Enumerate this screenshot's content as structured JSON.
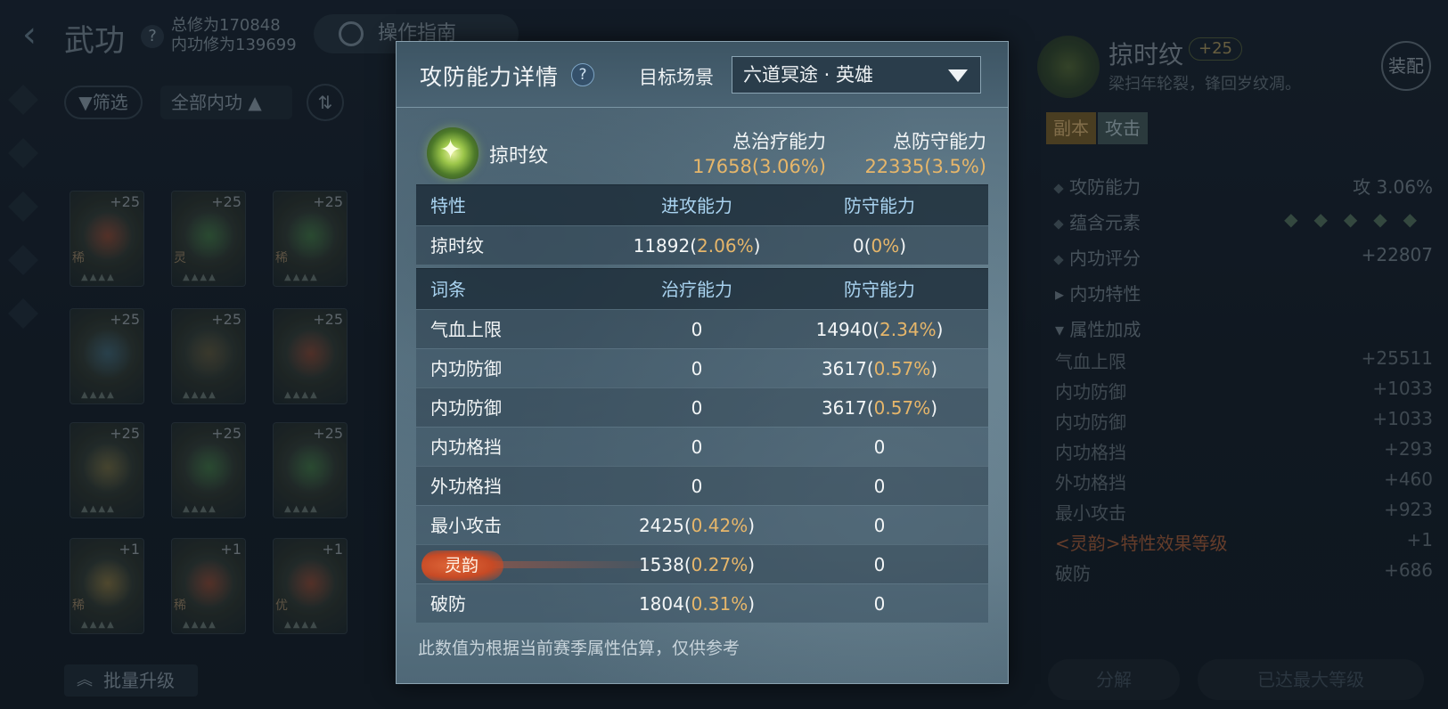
{
  "header": {
    "title": "武功",
    "help": "?",
    "total_cultivation": "总修为170848",
    "inner_cultivation": "内功修为139699",
    "guide_label": "操作指南"
  },
  "toolbar": {
    "filter_label": "筛选",
    "all_label": "全部内功",
    "sort_icon": "sort-icon",
    "batch_upgrade_label": "批量升级"
  },
  "grid": {
    "cards": [
      {
        "level": "+25",
        "rarity": "稀",
        "color": "#b2432a"
      },
      {
        "level": "+25",
        "rarity": "灵",
        "color": "#3f8a43"
      },
      {
        "level": "+25",
        "rarity": "稀",
        "color": "#3f8a43"
      },
      {
        "level": "+25",
        "rarity": "",
        "color": "#3c6f8c"
      },
      {
        "level": "+25",
        "rarity": "",
        "color": "#6b5a35"
      },
      {
        "level": "+25",
        "rarity": "",
        "color": "#a6402a"
      },
      {
        "level": "+25",
        "rarity": "",
        "color": "#8c7a3c"
      },
      {
        "level": "+25",
        "rarity": "",
        "color": "#3f8a43"
      },
      {
        "level": "+25",
        "rarity": "",
        "color": "#3f8a43"
      },
      {
        "level": "+1",
        "rarity": "稀",
        "color": "#a8863a"
      },
      {
        "level": "+1",
        "rarity": "稀",
        "color": "#b2432a"
      },
      {
        "level": "+1",
        "rarity": "优",
        "color": "#b2432a"
      }
    ]
  },
  "right_panel": {
    "name": "掠时纹",
    "plus": "+25",
    "description": "梁扫年轮裂，锋回岁纹凋。",
    "equip_label": "装配",
    "tags": [
      "副本",
      "攻击"
    ],
    "rows": [
      {
        "label": "攻防能力",
        "value": "攻 3.06%"
      },
      {
        "label": "蕴含元素",
        "value": ""
      },
      {
        "label": "内功评分",
        "value": "+22807"
      },
      {
        "label": "内功特性",
        "value": ""
      },
      {
        "label": "属性加成",
        "value": ""
      }
    ],
    "attrs": [
      {
        "label": "气血上限",
        "value": "+25511"
      },
      {
        "label": "内功防御",
        "value": "+1033"
      },
      {
        "label": "内功防御",
        "value": "+1033"
      },
      {
        "label": "内功格挡",
        "value": "+293"
      },
      {
        "label": "外功格挡",
        "value": "+460"
      },
      {
        "label": "最小攻击",
        "value": "+923"
      },
      {
        "label": "<灵韵>特性效果等级",
        "value": "+1"
      },
      {
        "label": "破防",
        "value": "+686"
      }
    ],
    "decompose_label": "分解",
    "max_level_label": "已达最大等级"
  },
  "modal": {
    "title": "攻防能力详情",
    "help": "?",
    "scene_label": "目标场景",
    "scene_value": "六道冥途 · 英雄",
    "item_name": "掠时纹",
    "total_heal_label": "总治疗能力",
    "total_heal_value": "17658",
    "total_heal_pct": "(3.06%)",
    "total_def_label": "总防守能力",
    "total_def_value": "22335",
    "total_def_pct": "(3.5%)",
    "trait_table": {
      "headers": [
        "特性",
        "进攻能力",
        "防守能力"
      ],
      "rows": [
        {
          "name": "掠时纹",
          "a_val": "11892",
          "a_pct": "2.06%",
          "d_val": "0",
          "d_pct": "0%"
        }
      ]
    },
    "entry_table": {
      "headers": [
        "词条",
        "治疗能力",
        "防守能力"
      ],
      "rows": [
        {
          "name": "气血上限",
          "a_val": "0",
          "a_pct": "",
          "d_val": "14940",
          "d_pct": "2.34%"
        },
        {
          "name": "内功防御",
          "a_val": "0",
          "a_pct": "",
          "d_val": "3617",
          "d_pct": "0.57%"
        },
        {
          "name": "内功防御",
          "a_val": "0",
          "a_pct": "",
          "d_val": "3617",
          "d_pct": "0.57%"
        },
        {
          "name": "内功格挡",
          "a_val": "0",
          "a_pct": "",
          "d_val": "0",
          "d_pct": ""
        },
        {
          "name": "外功格挡",
          "a_val": "0",
          "a_pct": "",
          "d_val": "0",
          "d_pct": ""
        },
        {
          "name": "最小攻击",
          "a_val": "2425",
          "a_pct": "0.42%",
          "d_val": "0",
          "d_pct": ""
        },
        {
          "name": "灵韵",
          "a_val": "1538",
          "a_pct": "0.27%",
          "d_val": "0",
          "d_pct": ""
        },
        {
          "name": "破防",
          "a_val": "1804",
          "a_pct": "0.31%",
          "d_val": "0",
          "d_pct": ""
        }
      ]
    },
    "footnote": "此数值为根据当前赛季属性估算，仅供参考"
  },
  "colors": {
    "accent_gold": "#e6b66a",
    "header_blue": "#a9d3f0",
    "lingyun_orange": "#d65a2e"
  }
}
